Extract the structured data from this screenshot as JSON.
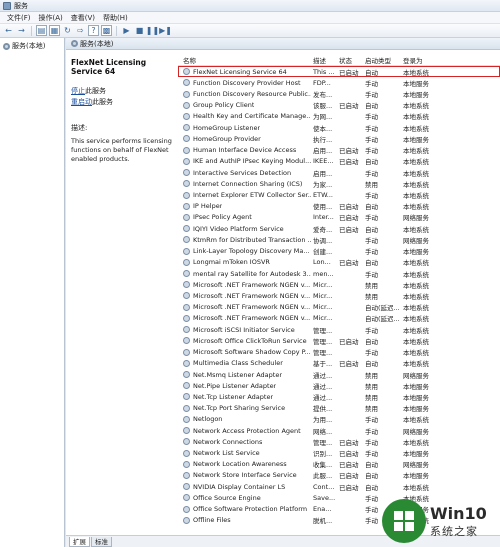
{
  "window": {
    "title": "服务"
  },
  "menubar": {
    "items": [
      "文件(F)",
      "操作(A)",
      "查看(V)",
      "帮助(H)"
    ]
  },
  "tree": {
    "root_label": "服务(本地)"
  },
  "pane": {
    "header": "服务(本地)"
  },
  "detail": {
    "service_name": "FlexNet Licensing Service 64",
    "stop_link": "停止",
    "stop_suffix": "此服务",
    "restart_link": "重启动",
    "restart_suffix": "此服务",
    "desc_label": "描述:",
    "desc_text": "This service performs licensing functions on behalf of FlexNet enabled products."
  },
  "list": {
    "columns": {
      "name": "名称",
      "description": "描述",
      "status": "状态",
      "startup": "启动类型",
      "logon": "登录为"
    },
    "rows": [
      {
        "name": "FlexNet Licensing Service 64",
        "description": "This ...",
        "status": "已启动",
        "startup": "自动",
        "logon": "本地系统",
        "selected": true
      },
      {
        "name": "Function Discovery Provider Host",
        "description": "FDP...",
        "status": "",
        "startup": "手动",
        "logon": "本地服务"
      },
      {
        "name": "Function Discovery Resource Public...",
        "description": "发布...",
        "status": "",
        "startup": "手动",
        "logon": "本地服务"
      },
      {
        "name": "Group Policy Client",
        "description": "该服...",
        "status": "已启动",
        "startup": "自动",
        "logon": "本地系统"
      },
      {
        "name": "Health Key and Certificate Manage...",
        "description": "为网...",
        "status": "",
        "startup": "手动",
        "logon": "本地系统"
      },
      {
        "name": "HomeGroup Listener",
        "description": "使本...",
        "status": "",
        "startup": "手动",
        "logon": "本地系统"
      },
      {
        "name": "HomeGroup Provider",
        "description": "执行...",
        "status": "",
        "startup": "手动",
        "logon": "本地服务"
      },
      {
        "name": "Human Interface Device Access",
        "description": "启用...",
        "status": "已启动",
        "startup": "手动",
        "logon": "本地系统"
      },
      {
        "name": "IKE and AuthIP IPsec Keying Modul...",
        "description": "IKEE...",
        "status": "已启动",
        "startup": "自动",
        "logon": "本地系统"
      },
      {
        "name": "Interactive Services Detection",
        "description": "启用...",
        "status": "",
        "startup": "手动",
        "logon": "本地系统"
      },
      {
        "name": "Internet Connection Sharing (ICS)",
        "description": "为家...",
        "status": "",
        "startup": "禁用",
        "logon": "本地系统"
      },
      {
        "name": "Internet Explorer ETW Collector Ser...",
        "description": "ETW...",
        "status": "",
        "startup": "手动",
        "logon": "本地系统"
      },
      {
        "name": "IP Helper",
        "description": "使用...",
        "status": "已启动",
        "startup": "自动",
        "logon": "本地系统"
      },
      {
        "name": "IPsec Policy Agent",
        "description": "Inter...",
        "status": "已启动",
        "startup": "手动",
        "logon": "网络服务"
      },
      {
        "name": "IQIYI Video Platform Service",
        "description": "爱奇...",
        "status": "已启动",
        "startup": "自动",
        "logon": "本地系统"
      },
      {
        "name": "KtmRm for Distributed Transaction ...",
        "description": "协调...",
        "status": "",
        "startup": "手动",
        "logon": "网络服务"
      },
      {
        "name": "Link-Layer Topology Discovery Ma...",
        "description": "创建...",
        "status": "",
        "startup": "手动",
        "logon": "本地服务"
      },
      {
        "name": "Longmai mToken IOSVR",
        "description": "Lon...",
        "status": "已启动",
        "startup": "自动",
        "logon": "本地系统"
      },
      {
        "name": "mental ray Satellite for Autodesk 3...",
        "description": "men...",
        "status": "",
        "startup": "手动",
        "logon": "本地系统"
      },
      {
        "name": "Microsoft .NET Framework NGEN v...",
        "description": "Micr...",
        "status": "",
        "startup": "禁用",
        "logon": "本地系统"
      },
      {
        "name": "Microsoft .NET Framework NGEN v...",
        "description": "Micr...",
        "status": "",
        "startup": "禁用",
        "logon": "本地系统"
      },
      {
        "name": "Microsoft .NET Framework NGEN v...",
        "description": "Micr...",
        "status": "",
        "startup": "自动(延迟...",
        "logon": "本地系统"
      },
      {
        "name": "Microsoft .NET Framework NGEN v...",
        "description": "Micr...",
        "status": "",
        "startup": "自动(延迟...",
        "logon": "本地系统"
      },
      {
        "name": "Microsoft iSCSI Initiator Service",
        "description": "管理...",
        "status": "",
        "startup": "手动",
        "logon": "本地系统"
      },
      {
        "name": "Microsoft Office ClickToRun Service",
        "description": "管理...",
        "status": "已启动",
        "startup": "自动",
        "logon": "本地系统"
      },
      {
        "name": "Microsoft Software Shadow Copy P...",
        "description": "管理...",
        "status": "",
        "startup": "手动",
        "logon": "本地系统"
      },
      {
        "name": "Multimedia Class Scheduler",
        "description": "基于...",
        "status": "已启动",
        "startup": "自动",
        "logon": "本地系统"
      },
      {
        "name": "Net.Msmq Listener Adapter",
        "description": "通过...",
        "status": "",
        "startup": "禁用",
        "logon": "网络服务"
      },
      {
        "name": "Net.Pipe Listener Adapter",
        "description": "通过...",
        "status": "",
        "startup": "禁用",
        "logon": "本地服务"
      },
      {
        "name": "Net.Tcp Listener Adapter",
        "description": "通过...",
        "status": "",
        "startup": "禁用",
        "logon": "本地服务"
      },
      {
        "name": "Net.Tcp Port Sharing Service",
        "description": "提供...",
        "status": "",
        "startup": "禁用",
        "logon": "本地服务"
      },
      {
        "name": "Netlogon",
        "description": "为用...",
        "status": "",
        "startup": "手动",
        "logon": "本地系统"
      },
      {
        "name": "Network Access Protection Agent",
        "description": "网络...",
        "status": "",
        "startup": "手动",
        "logon": "网络服务"
      },
      {
        "name": "Network Connections",
        "description": "管理...",
        "status": "已启动",
        "startup": "手动",
        "logon": "本地系统"
      },
      {
        "name": "Network List Service",
        "description": "识别...",
        "status": "已启动",
        "startup": "手动",
        "logon": "本地服务"
      },
      {
        "name": "Network Location Awareness",
        "description": "收集...",
        "status": "已启动",
        "startup": "自动",
        "logon": "网络服务"
      },
      {
        "name": "Network Store Interface Service",
        "description": "此服...",
        "status": "已启动",
        "startup": "自动",
        "logon": "本地服务"
      },
      {
        "name": "NVIDIA Display Container LS",
        "description": "Cont...",
        "status": "已启动",
        "startup": "自动",
        "logon": "本地系统"
      },
      {
        "name": "Office  Source Engine",
        "description": "Save...",
        "status": "",
        "startup": "手动",
        "logon": "本地系统"
      },
      {
        "name": "Office Software Protection Platform",
        "description": "Ena...",
        "status": "",
        "startup": "手动",
        "logon": "网络服务"
      },
      {
        "name": "Offline Files",
        "description": "脱机...",
        "status": "",
        "startup": "手动",
        "logon": "本地系统"
      }
    ]
  },
  "tabs": {
    "extended": "扩展",
    "standard": "标准"
  },
  "watermark": {
    "brand": "Win10",
    "subtitle": "系统之家"
  },
  "colors": {
    "selection_outline": "#d42424",
    "link": "#1a4fa0",
    "watermark_green": "#2a8a34"
  }
}
